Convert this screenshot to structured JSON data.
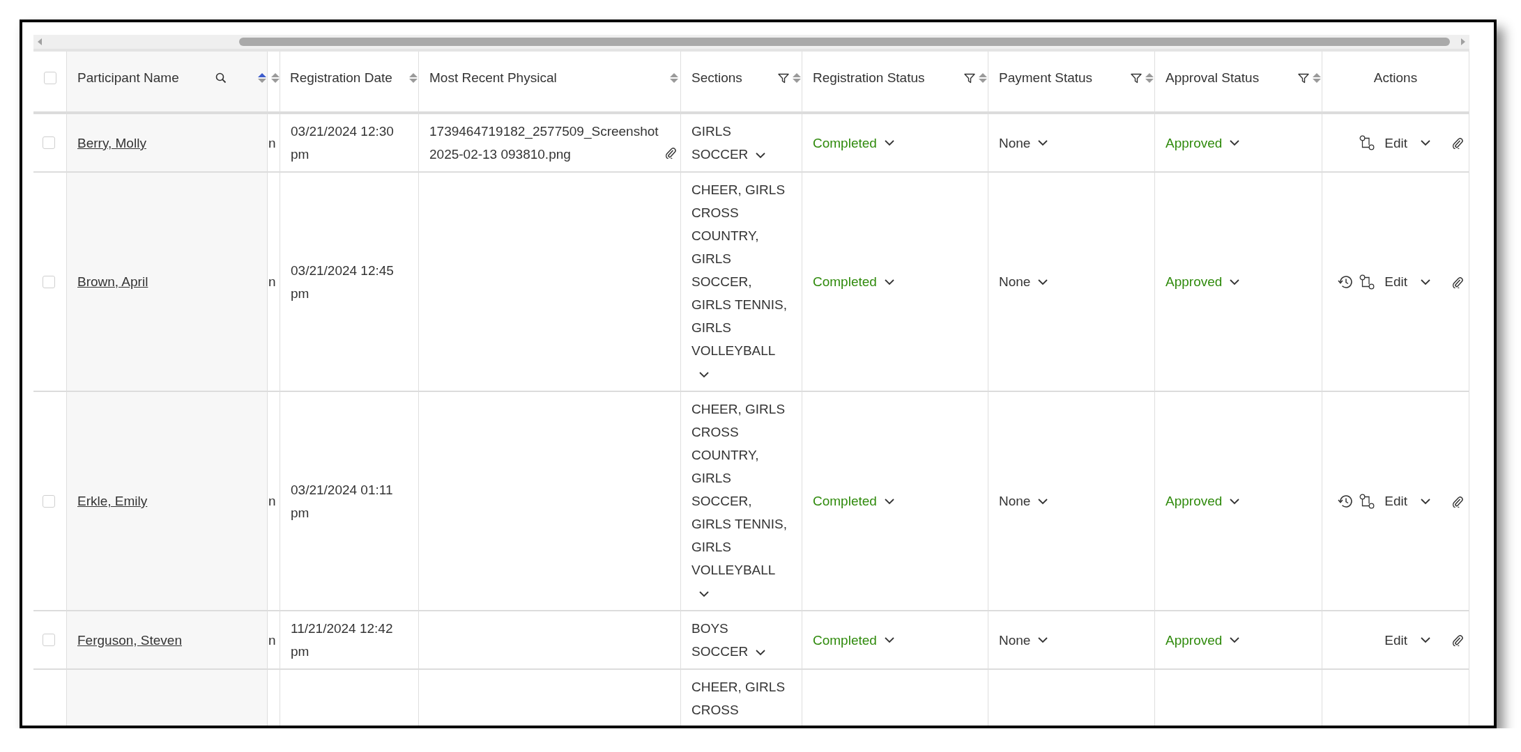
{
  "table": {
    "select_all": {
      "checked": false
    },
    "columns": [
      {
        "label": "Participant Name",
        "search": true,
        "sorted": true
      },
      {
        "sorted": false
      },
      {
        "label": "Registration Date",
        "sorted": false
      },
      {
        "label": "Most Recent Physical",
        "sorted": false
      },
      {
        "label": "Sections",
        "filter": true,
        "sorted": false
      },
      {
        "label": "Registration Status",
        "filter": true,
        "sorted": false
      },
      {
        "label": "Payment Status",
        "filter": true,
        "sorted": false
      },
      {
        "label": "Approval Status",
        "filter": true,
        "sorted": false
      },
      {
        "label": "Actions"
      }
    ],
    "rows": [
      {
        "checked": false,
        "name": "Berry, Molly",
        "column_2": "n",
        "registration_date": "03/21/2024 12:30 pm",
        "physical": {
          "file": "1739464719182_2577509_Screenshot 2025-02-13 093810.png",
          "attachment": true
        },
        "sections": {
          "text": "GIRLS SOCCER",
          "expandable": true
        },
        "registration_status": {
          "text": "Completed",
          "color": "#2f8a0c"
        },
        "payment_status": {
          "text": "None",
          "color": "#333333"
        },
        "approval_status": {
          "text": "Approved",
          "color": "#2f8a0c"
        },
        "actions": {
          "history": false,
          "workflow": true,
          "edit": "Edit",
          "attachment": true
        }
      },
      {
        "checked": false,
        "name": "Brown, April",
        "column_2": "n",
        "registration_date": "03/21/2024 12:45 pm",
        "sections": {
          "text": "CHEER, GIRLS CROSS COUNTRY, GIRLS SOCCER, GIRLS TENNIS, GIRLS VOLLEYBALL",
          "expandable": true
        },
        "registration_status": {
          "text": "Completed",
          "color": "#2f8a0c"
        },
        "payment_status": {
          "text": "None",
          "color": "#333333"
        },
        "approval_status": {
          "text": "Approved",
          "color": "#2f8a0c"
        },
        "actions": {
          "history": true,
          "workflow": true,
          "edit": "Edit",
          "attachment": true
        }
      },
      {
        "checked": false,
        "name": "Erkle, Emily",
        "column_2": "n",
        "registration_date": "03/21/2024 01:11 pm",
        "sections": {
          "text": "CHEER, GIRLS CROSS COUNTRY, GIRLS SOCCER, GIRLS TENNIS, GIRLS VOLLEYBALL",
          "expandable": true
        },
        "registration_status": {
          "text": "Completed",
          "color": "#2f8a0c"
        },
        "payment_status": {
          "text": "None",
          "color": "#333333"
        },
        "approval_status": {
          "text": "Approved",
          "color": "#2f8a0c"
        },
        "actions": {
          "history": true,
          "workflow": true,
          "edit": "Edit",
          "attachment": true
        }
      },
      {
        "checked": false,
        "name": "Ferguson, Steven",
        "column_2": "n",
        "registration_date": "11/21/2024 12:42 pm",
        "sections": {
          "text": "BOYS SOCCER",
          "expandable": true
        },
        "registration_status": {
          "text": "Completed",
          "color": "#2f8a0c"
        },
        "payment_status": {
          "text": "None",
          "color": "#333333"
        },
        "approval_status": {
          "text": "Approved",
          "color": "#2f8a0c"
        },
        "actions": {
          "history": false,
          "workflow": false,
          "edit": "Edit",
          "attachment": true
        }
      },
      {
        "sections": {
          "text": "CHEER, GIRLS CROSS"
        }
      }
    ]
  }
}
